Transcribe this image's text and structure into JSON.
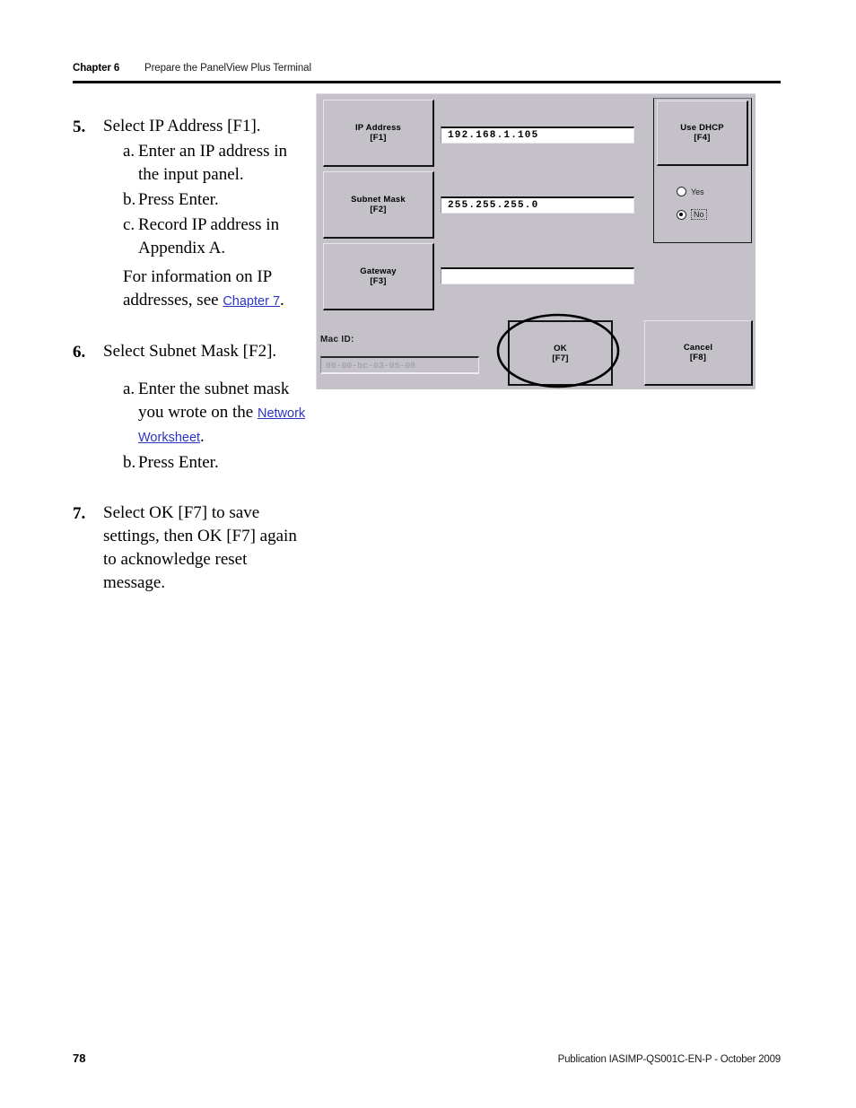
{
  "header": {
    "chapter": "Chapter 6",
    "title": "Prepare the PanelView Plus Terminal"
  },
  "steps": [
    {
      "number": "5.",
      "text": "Select IP Address [F1].",
      "substeps": [
        {
          "marker": "a.",
          "text": "Enter an IP address in the input panel."
        },
        {
          "marker": "b.",
          "text": "Press Enter."
        },
        {
          "marker": "c.",
          "text": "Record IP address in Appendix A."
        }
      ],
      "note_prefix": "For information on IP addresses, see ",
      "note_link": "Chapter 7",
      "note_suffix": "."
    },
    {
      "number": "6.",
      "text": "Select Subnet Mask [F2].",
      "substeps": [
        {
          "marker": "a.",
          "text_prefix": "Enter the subnet mask you wrote on the ",
          "link": "Network Worksheet",
          "text_suffix": "."
        },
        {
          "marker": "b.",
          "text": "Press Enter."
        }
      ]
    },
    {
      "number": "7.",
      "text": "Select OK [F7] to save settings, then OK [F7] again to acknowledge reset message."
    }
  ],
  "terminal": {
    "buttons": {
      "ip_address": {
        "label": "IP Address",
        "key": "[F1]"
      },
      "subnet_mask": {
        "label": "Subnet Mask",
        "key": "[F2]"
      },
      "gateway": {
        "label": "Gateway",
        "key": "[F3]"
      },
      "use_dhcp": {
        "label": "Use DHCP",
        "key": "[F4]"
      },
      "ok": {
        "label": "OK",
        "key": "[F7]"
      },
      "cancel": {
        "label": "Cancel",
        "key": "[F8]"
      }
    },
    "fields": {
      "ip_address_value": "192.168.1.105",
      "subnet_mask_value": "255.255.255.0",
      "gateway_value": ""
    },
    "dhcp": {
      "yes_label": "Yes",
      "no_label": "No",
      "selected": "No"
    },
    "mac": {
      "label": "Mac ID:",
      "value": "00-00-bc-03-05-08"
    },
    "colors": {
      "panel_background": "#c4c2c8",
      "field_background": "#ffffff",
      "border_dark": "#141414",
      "disabled_text": "#9795a0"
    }
  },
  "footer": {
    "page_number": "78",
    "publication": "Publication IASIMP-QS001C-EN-P - October 2009"
  },
  "link_color": "#2b35c4"
}
